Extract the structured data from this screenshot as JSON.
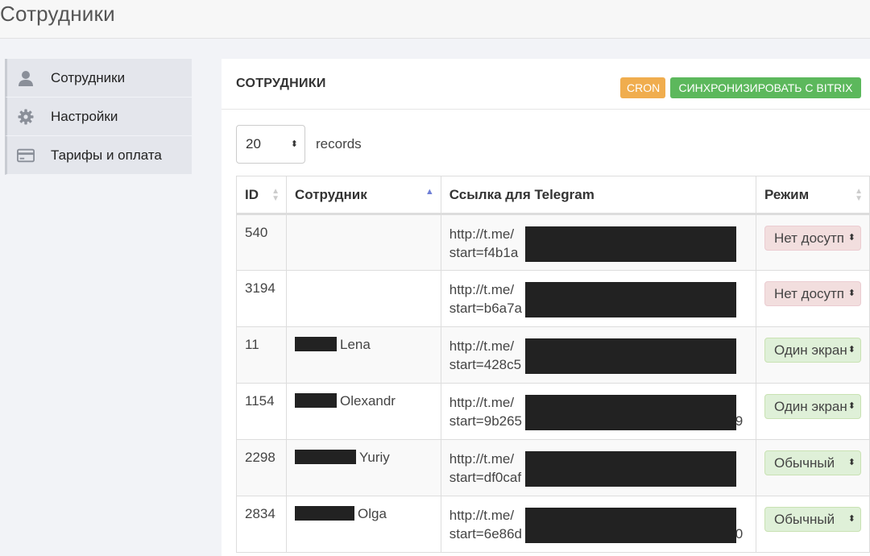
{
  "page": {
    "title": "Сотрудники"
  },
  "sidebar": {
    "items": [
      {
        "label": "Сотрудники",
        "icon": "user-icon"
      },
      {
        "label": "Настройки",
        "icon": "gear-icon"
      },
      {
        "label": "Тарифы и оплата",
        "icon": "credit-card-icon"
      }
    ]
  },
  "panel": {
    "title": "СОТРУДНИКИ",
    "cron_label": "CRON",
    "sync_label": "СИНХРОНИЗИРОВАТЬ С BITRIX"
  },
  "length": {
    "value": "20",
    "suffix": "records"
  },
  "table": {
    "headers": {
      "id": "ID",
      "employee": "Сотрудник",
      "link": "Ссылка для Telegram",
      "mode": "Режим"
    },
    "rows": [
      {
        "id": "540",
        "name_prefix": "",
        "name": "",
        "link_line1": "http://t.me/",
        "link_line2": "start=f4b1a",
        "link_tail": "",
        "mode": "Нет досутп",
        "mode_color": "#f2dede"
      },
      {
        "id": "3194",
        "name_prefix": "",
        "name": "",
        "link_line1": "http://t.me/",
        "link_line2": "start=b6a7a",
        "link_tail": "",
        "mode": "Нет досутп",
        "mode_color": "#f2dede"
      },
      {
        "id": "11",
        "name_prefix": "",
        "name": "Lena",
        "link_line1": "http://t.me/",
        "link_line2": "start=428c5",
        "link_tail": "",
        "mode": "Один экран",
        "mode_color": "#dff0d8"
      },
      {
        "id": "1154",
        "name_prefix": "",
        "name": "Olexandr",
        "link_line1": "http://t.me/",
        "link_line2": "start=9b265",
        "link_tail": "9",
        "mode": "Один экран",
        "mode_color": "#dff0d8"
      },
      {
        "id": "2298",
        "name_prefix": "",
        "name": "Yuriy",
        "link_line1": "http://t.me/",
        "link_line2": "start=df0caf",
        "link_tail": "",
        "mode": "Обычный",
        "mode_color": "#dff0d8"
      },
      {
        "id": "2834",
        "name_prefix": "",
        "name": "Olga",
        "link_line1": "http://t.me/",
        "link_line2": "start=6e86d",
        "link_tail": "0",
        "mode": "Обычный",
        "mode_color": "#dff0d8"
      }
    ]
  },
  "colors": {
    "cron": "#f0ad4e",
    "sync": "#5cb85c",
    "sort_active": "#6f7fd6"
  }
}
